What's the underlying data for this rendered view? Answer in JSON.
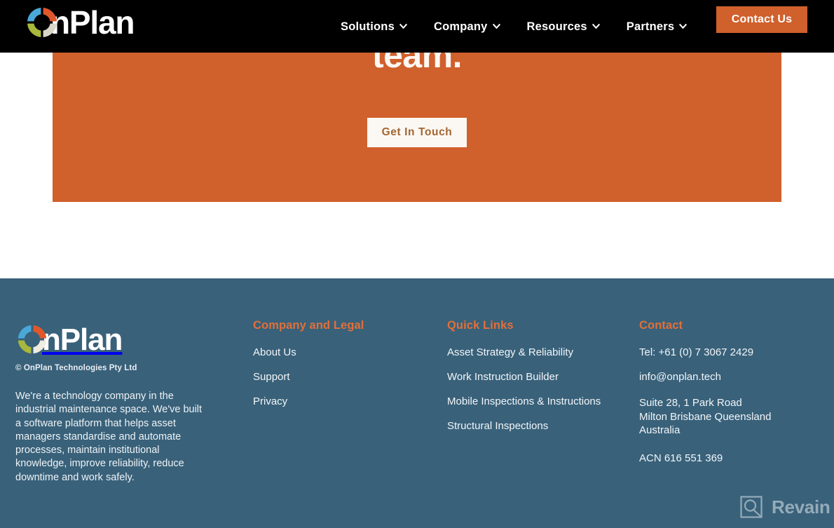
{
  "header": {
    "logo": {
      "icon": "onplan-ring-logo-icon",
      "wordmark": "nPlan",
      "ring_colors": {
        "top_left": "#4aa8d8",
        "top_right": "#e0572a",
        "bottom_right": "#d8d4c8",
        "bottom_left": "#a8b83c"
      }
    },
    "nav": [
      {
        "label": "Solutions",
        "icon": "chevron-down-icon"
      },
      {
        "label": "Company",
        "icon": "chevron-down-icon"
      },
      {
        "label": "Resources",
        "icon": "chevron-down-icon"
      },
      {
        "label": "Partners",
        "icon": "chevron-down-icon"
      }
    ],
    "contact_button": "Contact Us",
    "background": "#000000",
    "accent": "#d0602c"
  },
  "hero": {
    "headline": "team.",
    "cta_label": "Get In Touch",
    "background": "#d0602c",
    "cta_background": "#fbf8f4",
    "cta_text_color": "#a4652f"
  },
  "footer": {
    "background": "#39617a",
    "heading_color": "#e0703a",
    "logo": {
      "icon": "onplan-ring-logo-icon",
      "wordmark": "nPlan"
    },
    "copyright": "© OnPlan Technologies Pty Ltd",
    "description": "We're a technology company in the industrial maintenance space. We've built a software platform that helps asset managers standardise and automate processes, maintain institutional knowledge, improve reliability, reduce downtime and work safely.",
    "columns": [
      {
        "title": "Company and Legal",
        "links": [
          "About Us",
          "Support",
          "Privacy"
        ]
      },
      {
        "title": "Quick Links",
        "links": [
          "Asset Strategy & Reliability",
          "Work Instruction Builder",
          "Mobile Inspections & Instructions",
          "Structural Inspections"
        ]
      }
    ],
    "contact": {
      "title": "Contact",
      "phone": "Tel: +61 (0) 7 3067 2429",
      "email": "info@onplan.tech",
      "address": "Suite 28, 1 Park Road\nMilton Brisbane Queensland\nAustralia",
      "acn": "ACN 616 551 369"
    }
  },
  "watermark": {
    "label": "Revain",
    "icon": "revain-logo-icon"
  }
}
